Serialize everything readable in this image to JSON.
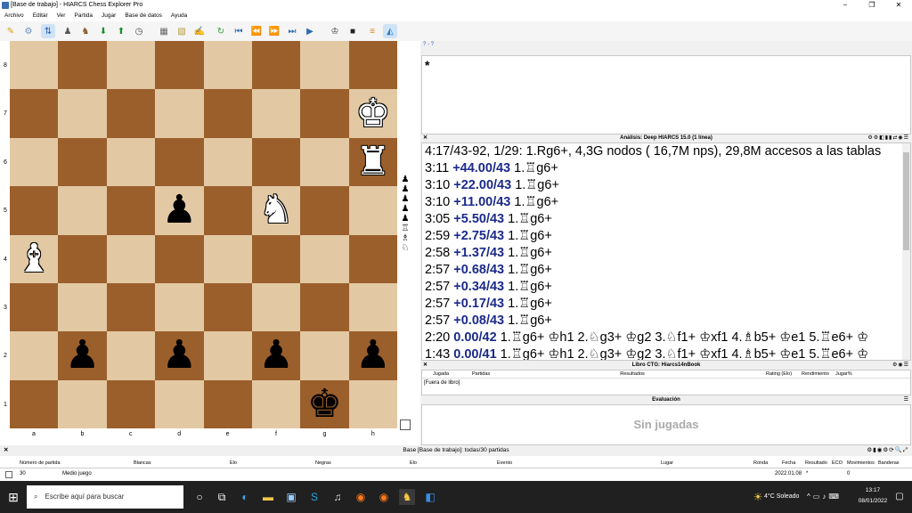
{
  "window": {
    "title": "[Base de trabajo] - HIARCS Chess Explorer Pro",
    "minimize": "−",
    "maximize": "❐",
    "close": "✕"
  },
  "menu": [
    "Archivo",
    "Editar",
    "Ver",
    "Partida",
    "Jugar",
    "Base de datos",
    "Ayuda"
  ],
  "toolbar": {
    "icon_names": [
      "new-icon",
      "open-icon",
      "flip-icon",
      "players-icon",
      "engine-icon",
      "down-icon",
      "up-icon",
      "clock-icon",
      "board-icon",
      "pattern-icon",
      "notes-icon",
      "refresh-icon",
      "first-icon",
      "prev-icon",
      "next-icon",
      "last-icon",
      "play-icon",
      "analysis-icon",
      "book-icon",
      "stack-icon",
      "highlight-icon"
    ]
  },
  "board": {
    "ranks": [
      "8",
      "7",
      "6",
      "5",
      "4",
      "3",
      "2",
      "1"
    ],
    "files": [
      "a",
      "b",
      "c",
      "d",
      "e",
      "f",
      "g",
      "h"
    ],
    "pieces": [
      {
        "square": "h7",
        "color": "white",
        "piece": "king",
        "glyph": "♚"
      },
      {
        "square": "h6",
        "color": "white",
        "piece": "rook",
        "glyph": "♜"
      },
      {
        "square": "d5",
        "color": "black",
        "piece": "pawn",
        "glyph": "♟"
      },
      {
        "square": "f5",
        "color": "white",
        "piece": "knight",
        "glyph": "♞"
      },
      {
        "square": "a4",
        "color": "white",
        "piece": "bishop",
        "glyph": "♝"
      },
      {
        "square": "b2",
        "color": "black",
        "piece": "pawn",
        "glyph": "♟"
      },
      {
        "square": "d2",
        "color": "black",
        "piece": "pawn",
        "glyph": "♟"
      },
      {
        "square": "f2",
        "color": "black",
        "piece": "pawn",
        "glyph": "♟"
      },
      {
        "square": "h2",
        "color": "black",
        "piece": "pawn",
        "glyph": "♟"
      },
      {
        "square": "g1",
        "color": "black",
        "piece": "king",
        "glyph": "♚"
      }
    ],
    "captured": [
      "♟",
      "♟",
      "♟",
      "♟",
      "♟",
      "♖",
      "♗",
      "♘"
    ],
    "light_color": "#e2c9a4",
    "dark_color": "#9b5f2c"
  },
  "notation": {
    "header": "? - ?",
    "text": "*"
  },
  "analysis": {
    "title": "Análisis: Deep HIARCS 15.0 (1 línea)",
    "header_line": "4:17/43-92, 1/29: 1.Rg6+, 4,3G nodos ( 16,7M nps), 29,8M accesos a las tablas",
    "lines": [
      {
        "time": "3:11",
        "eval": "+44.00/43",
        "moves": "1.♖g6+"
      },
      {
        "time": "3:10",
        "eval": "+22.00/43",
        "moves": "1.♖g6+"
      },
      {
        "time": "3:10",
        "eval": "+11.00/43",
        "moves": "1.♖g6+"
      },
      {
        "time": "3:05",
        "eval": "+5.50/43",
        "moves": "1.♖g6+"
      },
      {
        "time": "2:59",
        "eval": "+2.75/43",
        "moves": "1.♖g6+"
      },
      {
        "time": "2:58",
        "eval": "+1.37/43",
        "moves": "1.♖g6+"
      },
      {
        "time": "2:57",
        "eval": "+0.68/43",
        "moves": "1.♖g6+"
      },
      {
        "time": "2:57",
        "eval": "+0.34/43",
        "moves": "1.♖g6+"
      },
      {
        "time": "2:57",
        "eval": "+0.17/43",
        "moves": "1.♖g6+"
      },
      {
        "time": "2:57",
        "eval": "+0.08/43",
        "moves": "1.♖g6+"
      },
      {
        "time": "2:20",
        "eval": "0.00/42",
        "moves": "1.♖g6+ ♔h1 2.♘g3+ ♔g2 3.♘f1+ ♔xf1 4.♗b5+ ♔e1 5.♖e6+ ♔"
      },
      {
        "time": "1:43",
        "eval": "0.00/41",
        "moves": "1.♖g6+ ♔h1 2.♘g3+ ♔g2 3.♘f1+ ♔xf1 4.♗b5+ ♔e1 5.♖e6+ ♔"
      }
    ]
  },
  "book": {
    "title": "Libro CTG: Hiarcs14nBook",
    "columns": [
      "Jugada",
      "Partidas",
      "Resultados",
      "Rating (Elo)",
      "Rendimiento",
      "Jugar%"
    ],
    "status": "[Fuera de libro]"
  },
  "evaluation": {
    "title": "Evaluación",
    "empty_text": "Sin jugadas"
  },
  "database": {
    "title": "Base [Base de trabajo]: todas/30 partidas",
    "columns": [
      "Número de partida",
      "Blancas",
      "Elo",
      "Negras",
      "Elo",
      "Evento",
      "Lugar",
      "Ronda",
      "Fecha",
      "Resultado",
      "ECO",
      "Movimientos",
      "Banderas"
    ],
    "row": {
      "number": "30",
      "white": "Medio juego",
      "date": "2022.01.08",
      "result": "*",
      "moves": "0"
    }
  },
  "taskbar": {
    "search_placeholder": "Escribe aquí para buscar",
    "weather": "4°C  Soleado",
    "time": "13:17",
    "date": "08/01/2022"
  }
}
